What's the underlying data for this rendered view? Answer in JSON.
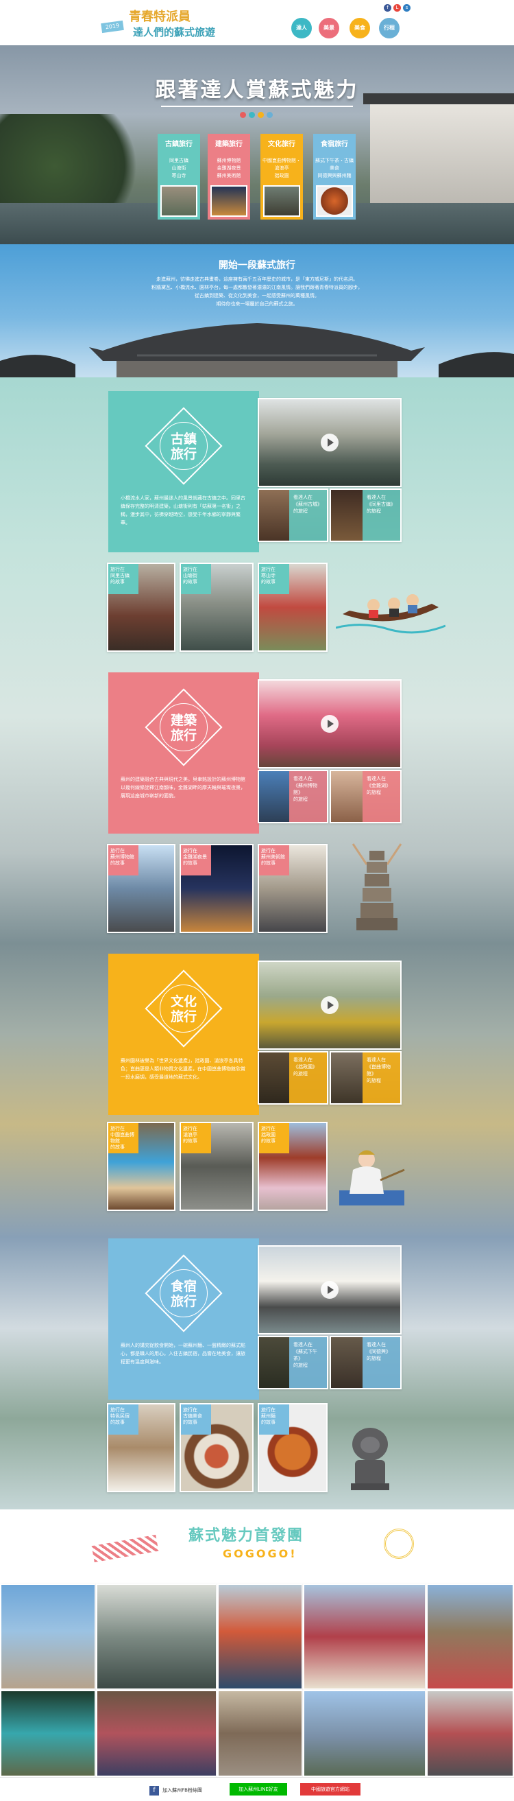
{
  "header": {
    "logo_line1": "青春特派員",
    "logo_line2": "達人們的蘇式旅遊",
    "logo_badge": "2019",
    "nav": [
      {
        "label": "達人",
        "color": "#3db8c5"
      },
      {
        "label": "美景",
        "color": "#ec6e7b"
      },
      {
        "label": "美食",
        "color": "#f7b21b"
      },
      {
        "label": "行程",
        "color": "#6ab0d6"
      }
    ],
    "social": [
      {
        "icon": "facebook-icon",
        "glyph": "f",
        "color": "#3b5998"
      },
      {
        "icon": "line-icon",
        "glyph": "L",
        "color": "#e8463c"
      },
      {
        "icon": "share-icon",
        "glyph": "s",
        "color": "#2f7ec2"
      }
    ]
  },
  "hero": {
    "title": "跟著達人賞蘇式魅力",
    "dots": [
      "#e85d5d",
      "#3db8c5",
      "#f7b21b",
      "#6ab0d6"
    ],
    "cards": [
      {
        "title": "古鎮旅行",
        "lines": [
          "同里古鎮",
          "山塘街",
          "寒山寺"
        ],
        "color": "#66c9bf"
      },
      {
        "title": "建築旅行",
        "lines": [
          "蘇州博物館",
          "金雞湖夜景",
          "蘇州美術館"
        ],
        "color": "#ec7f86"
      },
      {
        "title": "文化旅行",
        "lines": [
          "中國崑曲博物館・滄浪亭",
          "拙政園"
        ],
        "color": "#f7b21b"
      },
      {
        "title": "食宿旅行",
        "lines": [
          "蘇式下午茶・古鎮美食",
          "同德興與蘇州麵"
        ],
        "color": "#79bde0"
      }
    ]
  },
  "intro": {
    "title": "開始一段蘇式旅行",
    "text": [
      "走進蘇州，彷彿走進古典畫卷，這座擁有兩千五百年歷史的城市，是「東方威尼斯」的代名詞。",
      "粉牆黛瓦、小橋流水、園林亭台，每一處都散發著濃濃的江南風情。讓我們跟著青春特派員的腳步，",
      "從古鎮到建築、從文化到美食，一起感受蘇州的萬種風情。",
      "期待你也來一場屬於自己的蘇式之旅。"
    ]
  },
  "sections": [
    {
      "id": "ancient",
      "title": [
        "古鎮",
        "旅行"
      ],
      "color": "#66c9bf",
      "text": "小橋流水人家，蘇州最迷人的風景就藏在古鎮之中。同里古鎮保存完整的明清建築，山塘街則有「姑蘇第一名街」之稱，漫步其中，彷彿穿越時空，感受千年水鄉的寧靜與繁華。",
      "video_caps": [
        {
          "l1": "看達人在",
          "l2": "《蘇州古城》",
          "l3": "的旅程"
        },
        {
          "l1": "看達人在",
          "l2": "《同里古鎮》",
          "l3": "的旅程"
        }
      ],
      "row": [
        {
          "t": "旅行在",
          "p": "同里古鎮",
          "e": "的故事"
        },
        {
          "t": "旅行在",
          "p": "山塘街",
          "e": "的故事"
        },
        {
          "t": "旅行在",
          "p": "寒山寺",
          "e": "的故事"
        }
      ]
    },
    {
      "id": "architecture",
      "title": [
        "建築",
        "旅行"
      ],
      "color": "#ec7f86",
      "text": "蘇州的建築融合古典與現代之美。貝聿銘設計的蘇州博物館以幾何線條詮釋江南韻味，金雞湖畔的摩天輪與璀璨夜景，展現這座城市嶄新的面貌。",
      "video_caps": [
        {
          "l1": "看達人在",
          "l2": "《蘇州博物館》",
          "l3": "的旅程"
        },
        {
          "l1": "看達人在",
          "l2": "《金雞湖》",
          "l3": "的旅程"
        }
      ],
      "row": [
        {
          "t": "旅行在",
          "p": "蘇州博物館",
          "e": "的故事"
        },
        {
          "t": "旅行在",
          "p": "金雞湖夜景",
          "e": "的故事"
        },
        {
          "t": "旅行在",
          "p": "蘇州美術館",
          "e": "的故事"
        }
      ]
    },
    {
      "id": "culture",
      "title": [
        "文化",
        "旅行"
      ],
      "color": "#f7b21b",
      "text": "蘇州園林被譽為「世界文化遺產」，拙政園、滄浪亭各具特色；崑曲更是人類非物質文化遺產，在中國崑曲博物館欣賞一段水磨調，感受最道地的蘇式文化。",
      "video_caps": [
        {
          "l1": "看達人在",
          "l2": "《拙政園》",
          "l3": "的旅程"
        },
        {
          "l1": "看達人在",
          "l2": "《崑曲博物館》",
          "l3": "的旅程"
        }
      ],
      "row": [
        {
          "t": "旅行在",
          "p": "中國崑曲博物館",
          "e": "的故事"
        },
        {
          "t": "旅行在",
          "p": "滄浪亭",
          "e": "的故事"
        },
        {
          "t": "旅行在",
          "p": "拙政園",
          "e": "的故事"
        }
      ]
    },
    {
      "id": "food",
      "title": [
        "食宿",
        "旅行"
      ],
      "color": "#79bde0",
      "text": "蘇州人的講究從飲食開始，一碗蘇州麵、一盤精緻的蘇式點心，都是職人的用心。入住古鎮民宿，品嘗在地美食，讓旅程更有溫度與滋味。",
      "video_caps": [
        {
          "l1": "看達人在",
          "l2": "《蘇式下午茶》",
          "l3": "的旅程"
        },
        {
          "l1": "看達人在",
          "l2": "《同德興》",
          "l3": "的旅程"
        }
      ],
      "row": [
        {
          "t": "旅行在",
          "p": "特色民宿",
          "e": "的故事"
        },
        {
          "t": "旅行在",
          "p": "古鎮美食",
          "e": "的故事"
        },
        {
          "t": "旅行在",
          "p": "蘇州麵",
          "e": "的故事"
        }
      ]
    }
  ],
  "tour": {
    "title": "蘇式魅力首發團",
    "sub": "GOGOGO!"
  },
  "footer": {
    "fb": "加入蘇州FB粉絲團",
    "line": "加入蘇州LINE好友",
    "tw": "中國旅遊官方網站"
  }
}
